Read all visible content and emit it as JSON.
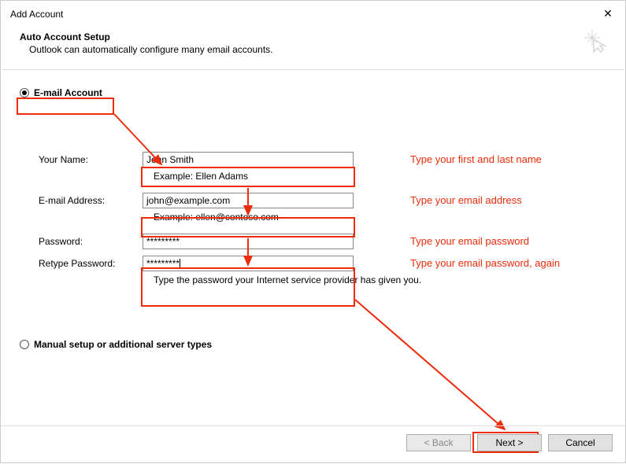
{
  "window": {
    "title": "Add Account"
  },
  "header": {
    "title": "Auto Account Setup",
    "subtitle": "Outlook can automatically configure many email accounts."
  },
  "radios": {
    "email_account": "E-mail Account",
    "manual": "Manual setup or additional server types"
  },
  "form": {
    "name_label": "Your Name:",
    "name_value": "John Smith",
    "name_example": "Example: Ellen Adams",
    "email_label": "E-mail Address:",
    "email_value": "john@example.com",
    "email_example": "Example: ellen@contoso.com",
    "password_label": "Password:",
    "password_value": "*********",
    "retype_label": "Retype Password:",
    "retype_value": "*********",
    "password_hint": "Type the password your Internet service provider has given you."
  },
  "annotations": {
    "name": "Type your first and last name",
    "email": "Type your email address",
    "password": "Type your email password",
    "retype": "Type your email password, again"
  },
  "buttons": {
    "back": "< Back",
    "next": "Next >",
    "cancel": "Cancel"
  }
}
